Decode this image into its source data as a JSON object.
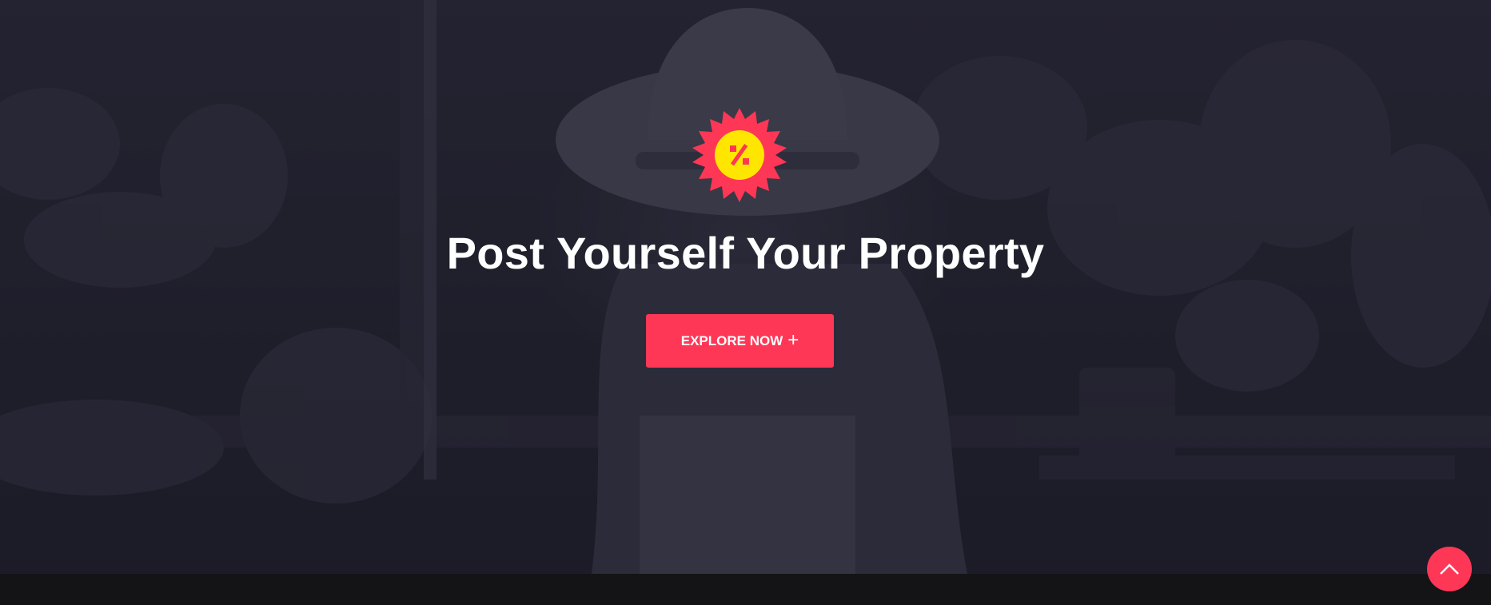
{
  "hero": {
    "title": "Post Yourself Your Property",
    "cta_label": "EXPLORE NOW",
    "cta_icon": "+",
    "badge_icon": "discount-badge-icon"
  },
  "scroll_top": {
    "icon": "chevron-up-icon"
  },
  "colors": {
    "accent": "#ff3756",
    "badge_inner": "#ffe600",
    "overlay": "#24232f",
    "footer": "#141417",
    "text": "#ffffff"
  }
}
